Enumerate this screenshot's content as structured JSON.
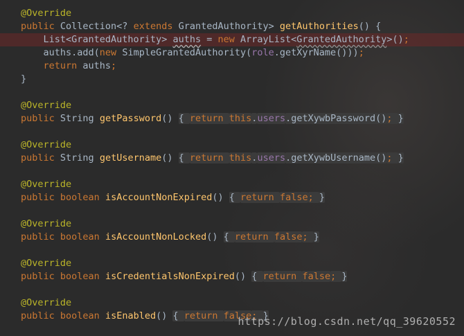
{
  "lines": [
    {
      "segments": [
        {
          "t": "@Override",
          "c": "ann"
        }
      ]
    },
    {
      "segments": [
        {
          "t": "public ",
          "c": "kw"
        },
        {
          "t": "Collection<? ",
          "c": "plain"
        },
        {
          "t": "extends ",
          "c": "kw"
        },
        {
          "t": "GrantedAuthority> ",
          "c": "plain"
        },
        {
          "t": "getAuthorities",
          "c": "fn"
        },
        {
          "t": "() {",
          "c": "plain"
        }
      ]
    },
    {
      "hl": true,
      "segments": [
        {
          "t": "    List<GrantedAuthority> ",
          "c": "plain"
        },
        {
          "t": "auths",
          "c": "plain squig"
        },
        {
          "t": " = ",
          "c": "plain"
        },
        {
          "t": "new ",
          "c": "kw"
        },
        {
          "t": "ArrayList<",
          "c": "plain"
        },
        {
          "t": "GrantedAuthority",
          "c": "plain squig2"
        },
        {
          "t": ">()",
          "c": "plain"
        },
        {
          "t": ";",
          "c": "kw"
        }
      ]
    },
    {
      "segments": [
        {
          "t": "    auths.add(",
          "c": "plain"
        },
        {
          "t": "new ",
          "c": "kw"
        },
        {
          "t": "SimpleGrantedAuthority(",
          "c": "plain"
        },
        {
          "t": "role",
          "c": "fld"
        },
        {
          "t": ".getXyrName()))",
          "c": "plain"
        },
        {
          "t": ";",
          "c": "kw"
        }
      ]
    },
    {
      "segments": [
        {
          "t": "    return ",
          "c": "kw"
        },
        {
          "t": "auths",
          "c": "plain"
        },
        {
          "t": ";",
          "c": "kw"
        }
      ]
    },
    {
      "segments": [
        {
          "t": "}",
          "c": "plain"
        }
      ]
    },
    {
      "segments": []
    },
    {
      "segments": [
        {
          "t": "@Override",
          "c": "ann"
        }
      ]
    },
    {
      "segments": [
        {
          "t": "public ",
          "c": "kw"
        },
        {
          "t": "String ",
          "c": "plain"
        },
        {
          "t": "getPassword",
          "c": "fn"
        },
        {
          "t": "() ",
          "c": "plain"
        },
        {
          "t": "{ ",
          "c": "plain fold"
        },
        {
          "t": "return ",
          "c": "kw fold"
        },
        {
          "t": "this",
          "c": "kw fold"
        },
        {
          "t": ".",
          "c": "plain fold"
        },
        {
          "t": "users",
          "c": "fld fold"
        },
        {
          "t": ".getXywbPassword()",
          "c": "plain fold"
        },
        {
          "t": "; ",
          "c": "kw fold"
        },
        {
          "t": "}",
          "c": "plain fold"
        }
      ]
    },
    {
      "segments": []
    },
    {
      "segments": [
        {
          "t": "@Override",
          "c": "ann"
        }
      ]
    },
    {
      "segments": [
        {
          "t": "public ",
          "c": "kw"
        },
        {
          "t": "String ",
          "c": "plain"
        },
        {
          "t": "getUsername",
          "c": "fn"
        },
        {
          "t": "() ",
          "c": "plain"
        },
        {
          "t": "{ ",
          "c": "plain fold"
        },
        {
          "t": "return ",
          "c": "kw fold"
        },
        {
          "t": "this",
          "c": "kw fold"
        },
        {
          "t": ".",
          "c": "plain fold"
        },
        {
          "t": "users",
          "c": "fld fold"
        },
        {
          "t": ".getXywbUsername()",
          "c": "plain fold"
        },
        {
          "t": "; ",
          "c": "kw fold"
        },
        {
          "t": "}",
          "c": "plain fold"
        }
      ]
    },
    {
      "segments": []
    },
    {
      "segments": [
        {
          "t": "@Override",
          "c": "ann"
        }
      ]
    },
    {
      "segments": [
        {
          "t": "public ",
          "c": "kw"
        },
        {
          "t": "boolean ",
          "c": "kw"
        },
        {
          "t": "isAccountNonExpired",
          "c": "fn"
        },
        {
          "t": "() ",
          "c": "plain"
        },
        {
          "t": "{ ",
          "c": "plain fold"
        },
        {
          "t": "return ",
          "c": "kw fold"
        },
        {
          "t": "false",
          "c": "kw fold"
        },
        {
          "t": "; ",
          "c": "kw fold"
        },
        {
          "t": "}",
          "c": "plain fold"
        }
      ]
    },
    {
      "segments": []
    },
    {
      "segments": [
        {
          "t": "@Override",
          "c": "ann"
        }
      ]
    },
    {
      "segments": [
        {
          "t": "public ",
          "c": "kw"
        },
        {
          "t": "boolean ",
          "c": "kw"
        },
        {
          "t": "isAccountNonLocked",
          "c": "fn"
        },
        {
          "t": "() ",
          "c": "plain"
        },
        {
          "t": "{ ",
          "c": "plain fold"
        },
        {
          "t": "return ",
          "c": "kw fold"
        },
        {
          "t": "false",
          "c": "kw fold"
        },
        {
          "t": "; ",
          "c": "kw fold"
        },
        {
          "t": "}",
          "c": "plain fold"
        }
      ]
    },
    {
      "segments": []
    },
    {
      "segments": [
        {
          "t": "@Override",
          "c": "ann"
        }
      ]
    },
    {
      "segments": [
        {
          "t": "public ",
          "c": "kw"
        },
        {
          "t": "boolean ",
          "c": "kw"
        },
        {
          "t": "isCredentialsNonExpired",
          "c": "fn"
        },
        {
          "t": "() ",
          "c": "plain"
        },
        {
          "t": "{ ",
          "c": "plain fold"
        },
        {
          "t": "return ",
          "c": "kw fold"
        },
        {
          "t": "false",
          "c": "kw fold"
        },
        {
          "t": "; ",
          "c": "kw fold"
        },
        {
          "t": "}",
          "c": "plain fold"
        }
      ]
    },
    {
      "segments": []
    },
    {
      "segments": [
        {
          "t": "@Override",
          "c": "ann"
        }
      ]
    },
    {
      "segments": [
        {
          "t": "public ",
          "c": "kw"
        },
        {
          "t": "boolean ",
          "c": "kw"
        },
        {
          "t": "isEnabled",
          "c": "fn"
        },
        {
          "t": "() ",
          "c": "plain"
        },
        {
          "t": "{ ",
          "c": "plain fold"
        },
        {
          "t": "return ",
          "c": "kw fold"
        },
        {
          "t": "false",
          "c": "kw fold"
        },
        {
          "t": "; ",
          "c": "kw fold"
        },
        {
          "t": "}",
          "c": "plain fold"
        }
      ]
    }
  ],
  "watermark": "https://blog.csdn.net/qq_39620552",
  "colors": {
    "background": "#2b2b2b",
    "keyword": "#cc7832",
    "annotation": "#bbb529",
    "method": "#ffc66d",
    "field": "#9876aa",
    "text": "#a9b7c6",
    "error_line": "#6e2828"
  }
}
